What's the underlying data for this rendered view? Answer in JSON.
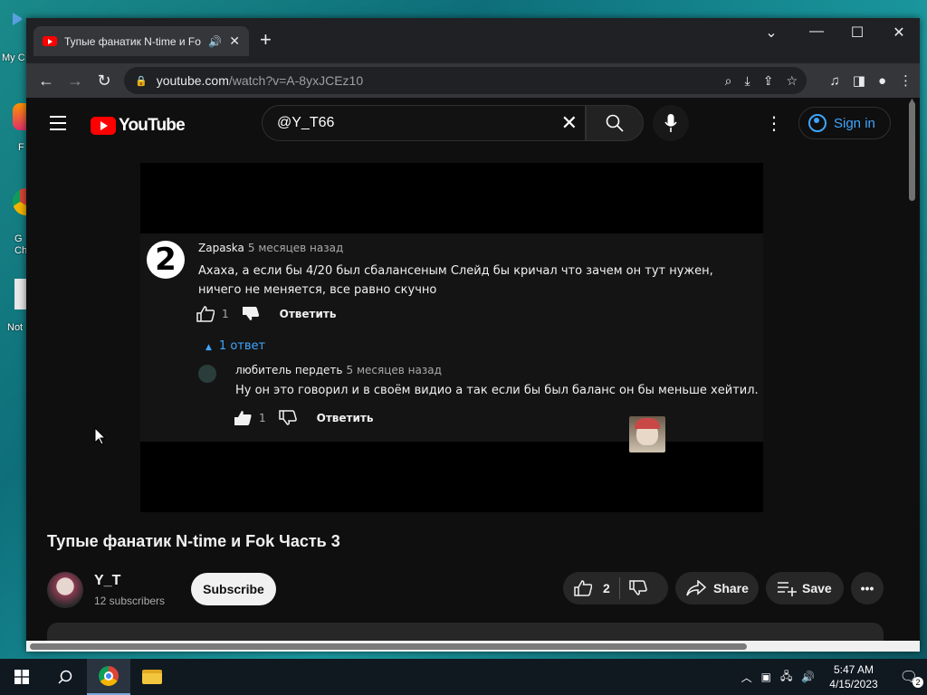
{
  "desktop": {
    "icons": [
      {
        "label": "My C",
        "icon": "computer-icon"
      },
      {
        "label": "F",
        "icon": "firefox-icon"
      },
      {
        "label": "G Ch",
        "icon": "chrome-icon"
      },
      {
        "label": "Not",
        "icon": "notepad-icon"
      }
    ]
  },
  "browser": {
    "tab": {
      "title": "Тупые фанатик N-time и Fok",
      "audio_icon": "speaker-icon"
    },
    "url_host": "youtube.com",
    "url_path": "/watch?v=A-8yxJCEz10"
  },
  "youtube": {
    "logo_text": "YouTube",
    "search_value": "@Y_T66",
    "signin_label": "Sign in",
    "video": {
      "comment": {
        "avatar_text": "2",
        "author": "Zapaska",
        "time": "5 месяцев назад",
        "text": "Ахаха, а если бы 4/20  был сбалансеным Слейд бы кричал что зачем он тут нужен, ничего не меняется, все равно скучно",
        "likes": "1",
        "reply_label": "Ответить"
      },
      "replies_toggle": "1 ответ",
      "reply": {
        "author": "любитель пердеть",
        "time": "5 месяцев назад",
        "text": "Ну он это говорил и в своём видио а так если бы был баланс он бы меньше хейтил.",
        "likes": "1",
        "reply_label": "Ответить"
      }
    },
    "title": "Тупые фанатик N-time и Fok Часть 3",
    "channel": {
      "name": "Y_T",
      "subscribers": "12 subscribers"
    },
    "subscribe_label": "Subscribe",
    "likes": "2",
    "share_label": "Share",
    "save_label": "Save"
  },
  "taskbar": {
    "time": "5:47 AM",
    "date": "4/15/2023",
    "notifications": "2"
  }
}
